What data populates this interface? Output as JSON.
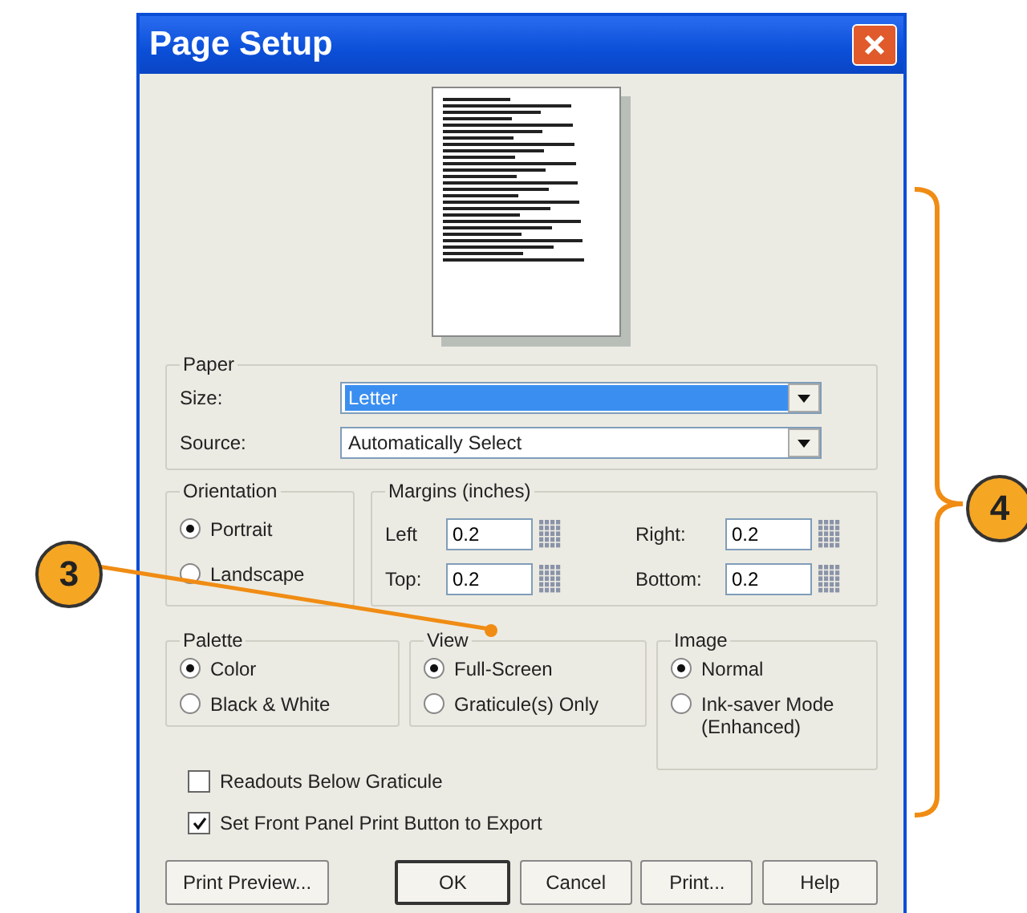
{
  "window": {
    "title": "Page Setup"
  },
  "paper": {
    "label": "Paper",
    "fields": [
      {
        "label": "Size:",
        "value": "Letter",
        "focused": true
      },
      {
        "label": "Source:",
        "value": "Automatically Select",
        "focused": false
      }
    ]
  },
  "orientation": {
    "label": "Orientation",
    "options": [
      {
        "label": "Portrait",
        "selected": true
      },
      {
        "label": "Landscape",
        "selected": false
      }
    ]
  },
  "margins": {
    "label": "Margins (inches)",
    "fields": [
      {
        "label": "Left",
        "value": "0.2"
      },
      {
        "label": "Right:",
        "value": "0.2"
      },
      {
        "label": "Top:",
        "value": "0.2"
      },
      {
        "label": "Bottom:",
        "value": "0.2"
      }
    ]
  },
  "palette": {
    "label": "Palette",
    "options": [
      {
        "label": "Color",
        "selected": true
      },
      {
        "label": "Black & White",
        "selected": false
      }
    ]
  },
  "view": {
    "label": "View",
    "options": [
      {
        "label": "Full-Screen",
        "selected": true
      },
      {
        "label": "Graticule(s) Only",
        "selected": false
      }
    ]
  },
  "image": {
    "label": "Image",
    "options": [
      {
        "label": "Normal",
        "selected": true
      },
      {
        "label": "Ink-saver Mode (Enhanced)",
        "selected": false
      }
    ]
  },
  "checkboxes": [
    {
      "label": "Readouts Below Graticule",
      "checked": false
    },
    {
      "label": "Set Front Panel Print Button to Export",
      "checked": true
    }
  ],
  "buttons": [
    {
      "label": "Print Preview...",
      "default": false
    },
    {
      "label": "OK",
      "default": true
    },
    {
      "label": "Cancel",
      "default": false
    },
    {
      "label": "Print...",
      "default": false
    },
    {
      "label": "Help",
      "default": false
    }
  ],
  "callouts": [
    {
      "label": "3"
    },
    {
      "label": "4"
    }
  ]
}
